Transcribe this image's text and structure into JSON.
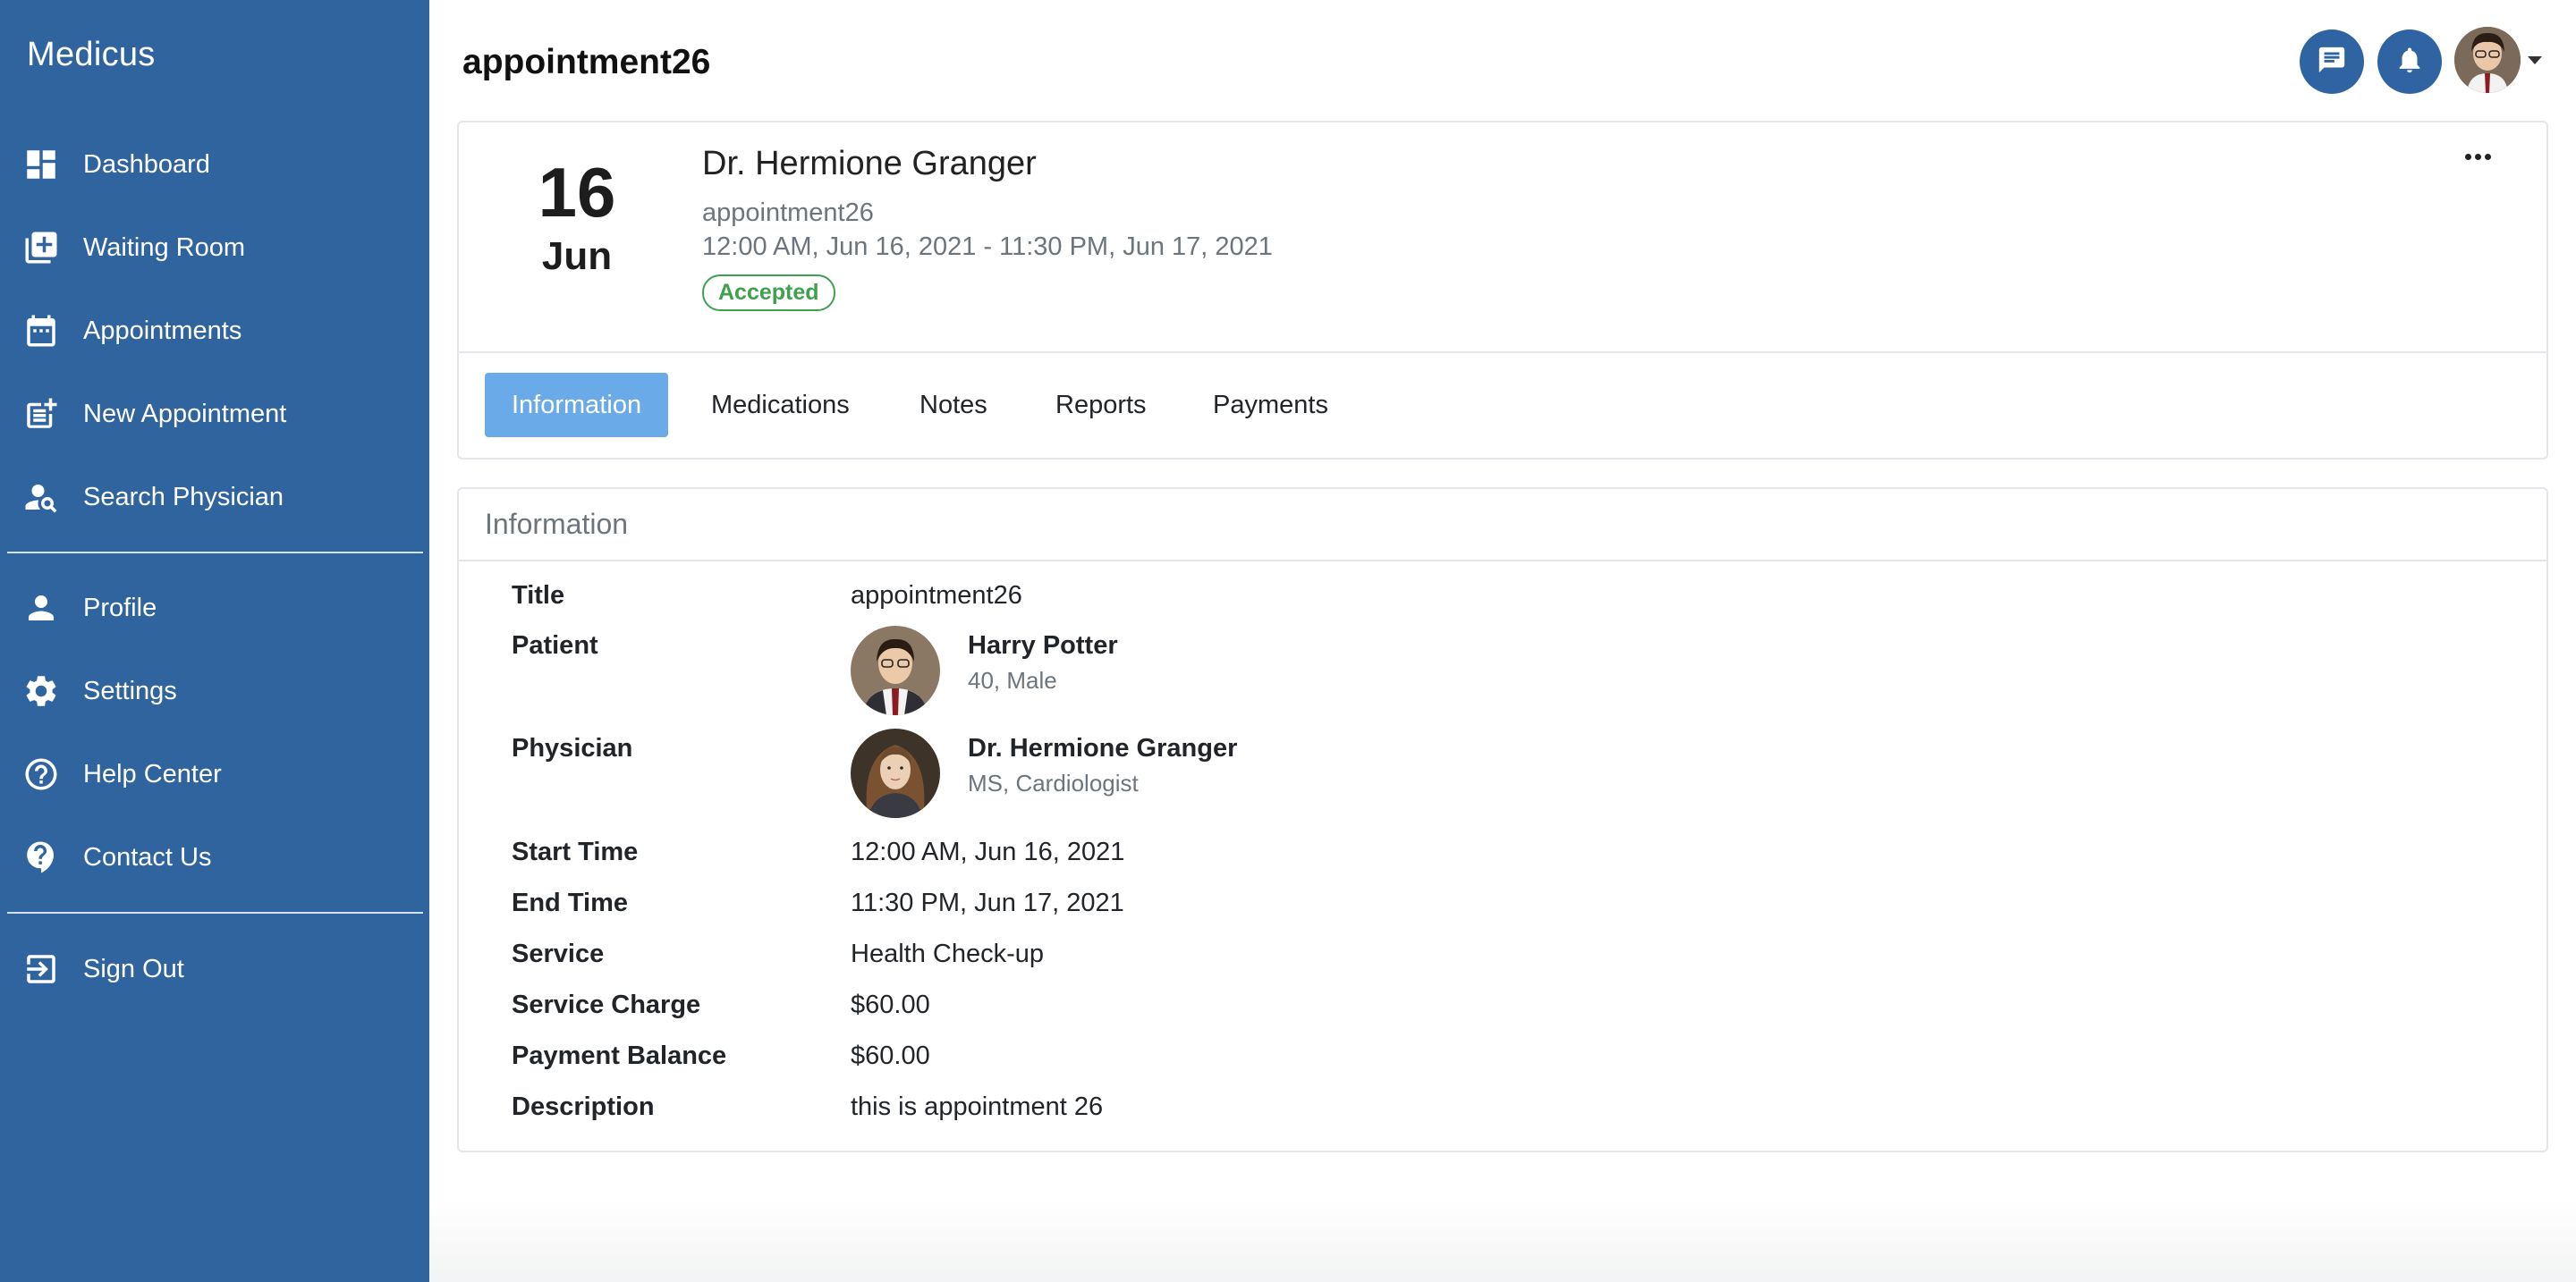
{
  "app": {
    "brand": "Medicus"
  },
  "sidebar": {
    "items": [
      {
        "label": "Dashboard",
        "icon": "dashboard-icon"
      },
      {
        "label": "Waiting Room",
        "icon": "queue-add-icon"
      },
      {
        "label": "Appointments",
        "icon": "calendar-icon"
      },
      {
        "label": "New Appointment",
        "icon": "post-add-icon"
      },
      {
        "label": "Search Physician",
        "icon": "person-search-icon"
      },
      {
        "label": "Profile",
        "icon": "person-icon"
      },
      {
        "label": "Settings",
        "icon": "gear-icon"
      },
      {
        "label": "Help Center",
        "icon": "help-circle-icon"
      },
      {
        "label": "Contact Us",
        "icon": "help-bubble-icon"
      },
      {
        "label": "Sign Out",
        "icon": "logout-icon"
      }
    ]
  },
  "header": {
    "title": "appointment26",
    "icons": [
      "chat-icon",
      "bell-icon",
      "user-avatar"
    ]
  },
  "appointment": {
    "day": "16",
    "month": "Jun",
    "physician_name": "Dr. Hermione Granger",
    "title": "appointment26",
    "time_range": "12:00 AM, Jun 16, 2021 - 11:30 PM, Jun 17, 2021",
    "status": "Accepted",
    "status_color": "#3fa04f"
  },
  "tabs": [
    {
      "label": "Information",
      "active": true
    },
    {
      "label": "Medications",
      "active": false
    },
    {
      "label": "Notes",
      "active": false
    },
    {
      "label": "Reports",
      "active": false
    },
    {
      "label": "Payments",
      "active": false
    }
  ],
  "info": {
    "heading": "Information",
    "labels": {
      "title": "Title",
      "patient": "Patient",
      "physician": "Physician",
      "start_time": "Start Time",
      "end_time": "End Time",
      "service": "Service",
      "service_charge": "Service Charge",
      "payment_balance": "Payment Balance",
      "description": "Description"
    },
    "values": {
      "title": "appointment26",
      "patient_name": "Harry Potter",
      "patient_meta": "40, Male",
      "physician_name": "Dr. Hermione Granger",
      "physician_meta": "MS, Cardiologist",
      "start_time": "12:00 AM, Jun 16, 2021",
      "end_time": "11:30 PM, Jun 17, 2021",
      "service": "Health Check-up",
      "service_charge": "$60.00",
      "payment_balance": "$60.00",
      "description": "this is appointment 26"
    }
  },
  "colors": {
    "sidebar": "#30649f",
    "accent": "#2f63a1",
    "active_tab": "#6aaae8"
  }
}
